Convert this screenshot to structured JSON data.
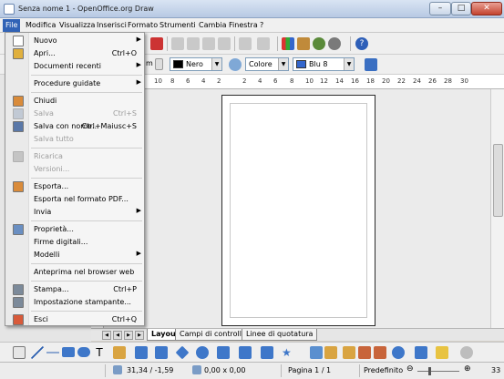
{
  "window": {
    "title": "Senza nome 1 - OpenOffice.org Draw"
  },
  "menubar": [
    "File",
    "Modifica",
    "Visualizza",
    "Inserisci",
    "Formato",
    "Strumenti",
    "Cambia",
    "Finestra",
    "?"
  ],
  "toolbar2": {
    "unit_fragment": "m",
    "line_color": {
      "label": "Nero",
      "hex": "#000000"
    },
    "fill_type": "Colore",
    "fill_color": {
      "label": "Blu 8",
      "hex": "#3366cc"
    }
  },
  "ruler_h": [
    "10",
    "8",
    "6",
    "4",
    "2",
    "2",
    "4",
    "6",
    "8",
    "10",
    "12",
    "14",
    "16",
    "18",
    "20",
    "22",
    "24",
    "26",
    "28",
    "30"
  ],
  "tabs": [
    "Layout",
    "Campi di controllo",
    "Linee di quotatura"
  ],
  "status": {
    "position": "31,34 / -1,59",
    "size": "0,00 x 0,00",
    "page": "Pagina 1 / 1",
    "style": "Predefinito",
    "zoom": "33"
  },
  "file_menu": [
    {
      "label": "Nuovo",
      "shortcut": "",
      "submenu": true,
      "disabled": false,
      "icon": "new-document-icon"
    },
    {
      "label": "Apri...",
      "shortcut": "Ctrl+O",
      "submenu": false,
      "disabled": false,
      "icon": "open-folder-icon"
    },
    {
      "label": "Documenti recenti",
      "shortcut": "",
      "submenu": true,
      "disabled": false,
      "icon": ""
    },
    {
      "sep": true
    },
    {
      "label": "Procedure guidate",
      "shortcut": "",
      "submenu": true,
      "disabled": false,
      "icon": ""
    },
    {
      "sep": true
    },
    {
      "label": "Chiudi",
      "shortcut": "",
      "submenu": false,
      "disabled": false,
      "icon": "close-document-icon"
    },
    {
      "label": "Salva",
      "shortcut": "Ctrl+S",
      "submenu": false,
      "disabled": true,
      "icon": "save-icon"
    },
    {
      "label": "Salva con nome...",
      "shortcut": "Ctrl+Maiusc+S",
      "submenu": false,
      "disabled": false,
      "icon": "save-as-icon"
    },
    {
      "label": "Salva tutto",
      "shortcut": "",
      "submenu": false,
      "disabled": true,
      "icon": ""
    },
    {
      "sep": true
    },
    {
      "label": "Ricarica",
      "shortcut": "",
      "submenu": false,
      "disabled": true,
      "icon": "reload-icon"
    },
    {
      "label": "Versioni...",
      "shortcut": "",
      "submenu": false,
      "disabled": true,
      "icon": ""
    },
    {
      "sep": true
    },
    {
      "label": "Esporta...",
      "shortcut": "",
      "submenu": false,
      "disabled": false,
      "icon": "export-icon"
    },
    {
      "label": "Esporta nel formato PDF...",
      "shortcut": "",
      "submenu": false,
      "disabled": false,
      "icon": ""
    },
    {
      "label": "Invia",
      "shortcut": "",
      "submenu": true,
      "disabled": false,
      "icon": ""
    },
    {
      "sep": true
    },
    {
      "label": "Proprietà...",
      "shortcut": "",
      "submenu": false,
      "disabled": false,
      "icon": "properties-icon"
    },
    {
      "label": "Firme digitali...",
      "shortcut": "",
      "submenu": false,
      "disabled": false,
      "icon": ""
    },
    {
      "label": "Modelli",
      "shortcut": "",
      "submenu": true,
      "disabled": false,
      "icon": ""
    },
    {
      "sep": true
    },
    {
      "label": "Anteprima nel browser web",
      "shortcut": "",
      "submenu": false,
      "disabled": false,
      "icon": ""
    },
    {
      "sep": true
    },
    {
      "label": "Stampa...",
      "shortcut": "Ctrl+P",
      "submenu": false,
      "disabled": false,
      "icon": "print-icon"
    },
    {
      "label": "Impostazione stampante...",
      "shortcut": "",
      "submenu": false,
      "disabled": false,
      "icon": "printer-settings-icon"
    },
    {
      "sep": true
    },
    {
      "label": "Esci",
      "shortcut": "Ctrl+Q",
      "submenu": false,
      "disabled": false,
      "icon": "exit-icon"
    }
  ]
}
